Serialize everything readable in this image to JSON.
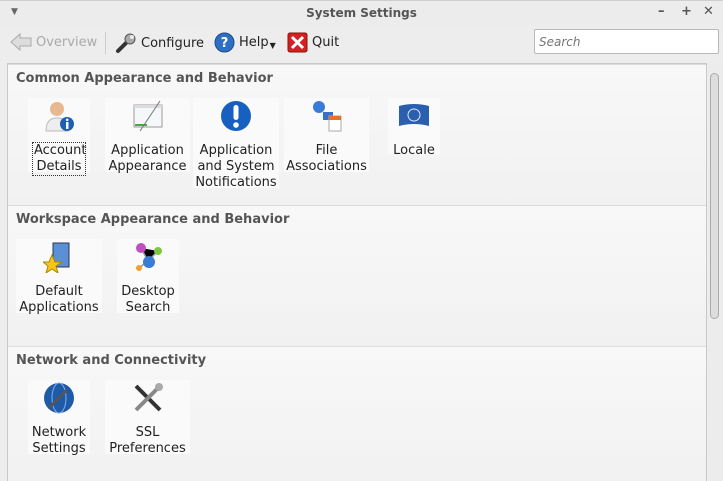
{
  "window": {
    "title": "System Settings"
  },
  "toolbar": {
    "overview": "Overview",
    "configure": "Configure",
    "help": "Help",
    "quit": "Quit",
    "search_placeholder": "Search"
  },
  "sections": [
    {
      "title": "Common Appearance and Behavior",
      "items": [
        {
          "label": "Account Details",
          "icon": "account-icon"
        },
        {
          "label": "Application Appearance",
          "icon": "appearance-icon"
        },
        {
          "label": "Application and System Notifications",
          "icon": "notification-icon"
        },
        {
          "label": "File Associations",
          "icon": "file-associations-icon"
        },
        {
          "label": "Locale",
          "icon": "locale-flag-icon"
        }
      ]
    },
    {
      "title": "Workspace Appearance and Behavior",
      "items": [
        {
          "label": "Default Applications",
          "icon": "default-apps-icon"
        },
        {
          "label": "Desktop Search",
          "icon": "desktop-search-icon"
        }
      ]
    },
    {
      "title": "Network and Connectivity",
      "items": [
        {
          "label": "Network Settings",
          "icon": "network-globe-icon"
        },
        {
          "label": "SSL Preferences",
          "icon": "ssl-tools-icon"
        }
      ]
    }
  ]
}
